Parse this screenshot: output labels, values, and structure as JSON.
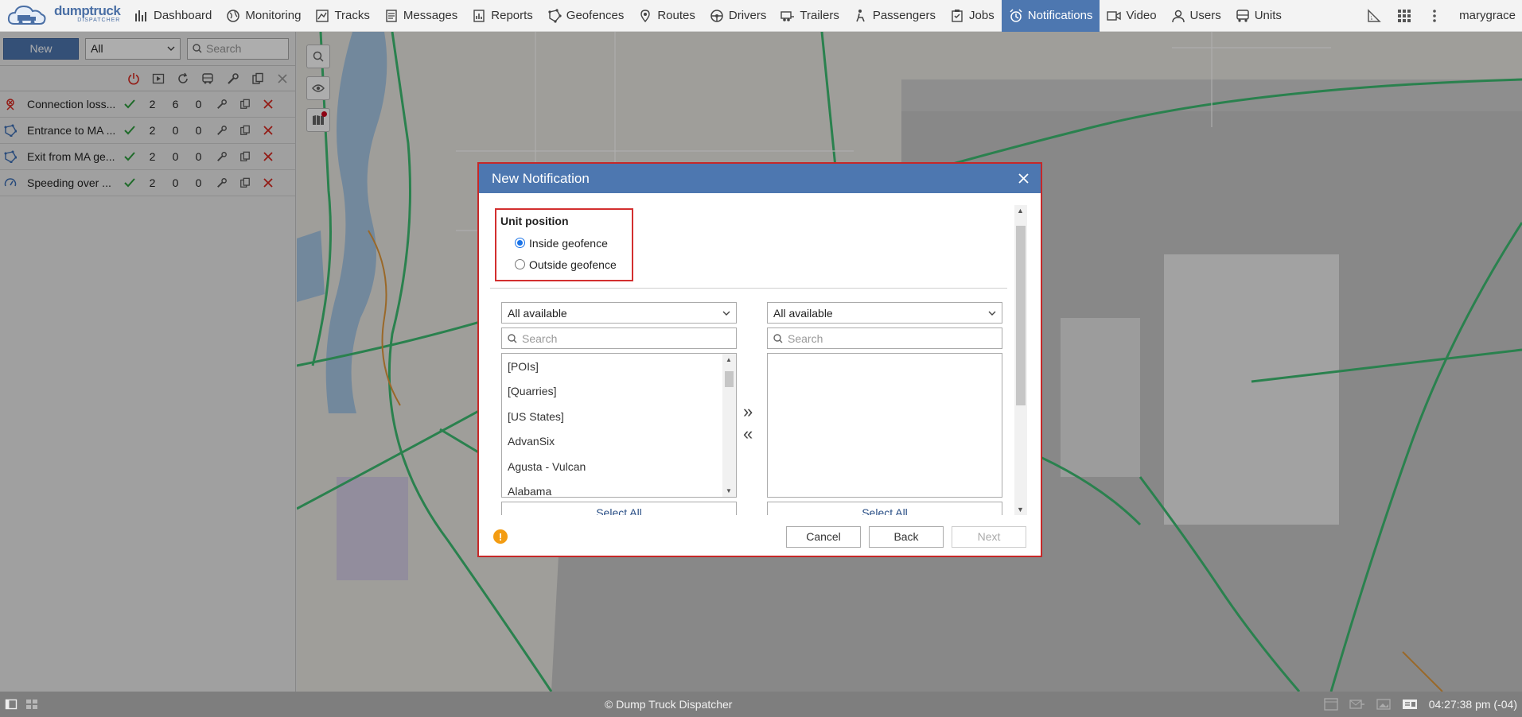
{
  "app": {
    "logo_main": "dumptruck",
    "logo_sub": "DISPATCHER",
    "username": "marygrace"
  },
  "nav": [
    {
      "label": "Dashboard",
      "icon": "bar-chart-icon"
    },
    {
      "label": "Monitoring",
      "icon": "globe-icon"
    },
    {
      "label": "Tracks",
      "icon": "track-icon"
    },
    {
      "label": "Messages",
      "icon": "messages-icon"
    },
    {
      "label": "Reports",
      "icon": "reports-icon"
    },
    {
      "label": "Geofences",
      "icon": "geofence-icon"
    },
    {
      "label": "Routes",
      "icon": "routes-icon"
    },
    {
      "label": "Drivers",
      "icon": "steering-wheel-icon"
    },
    {
      "label": "Trailers",
      "icon": "trailer-icon"
    },
    {
      "label": "Passengers",
      "icon": "passenger-icon"
    },
    {
      "label": "Jobs",
      "icon": "jobs-icon"
    },
    {
      "label": "Notifications",
      "icon": "alarm-clock-icon",
      "active": true
    },
    {
      "label": "Video",
      "icon": "video-icon"
    },
    {
      "label": "Users",
      "icon": "user-icon"
    },
    {
      "label": "Units",
      "icon": "bus-icon"
    }
  ],
  "left_panel": {
    "new_label": "New",
    "filter_value": "All",
    "search_placeholder": "Search",
    "rows": [
      {
        "name": "Connection loss...",
        "c1": "2",
        "c2": "6",
        "c3": "0",
        "icon": "connection-loss-icon"
      },
      {
        "name": "Entrance to MA ...",
        "c1": "2",
        "c2": "0",
        "c3": "0",
        "icon": "geofence-icon"
      },
      {
        "name": "Exit from MA ge...",
        "c1": "2",
        "c2": "0",
        "c3": "0",
        "icon": "geofence-icon"
      },
      {
        "name": "Speeding over ...",
        "c1": "2",
        "c2": "0",
        "c3": "0",
        "icon": "speedometer-icon"
      }
    ]
  },
  "dialog": {
    "title": "New Notification",
    "unit_position_header": "Unit position",
    "radio_inside": "Inside geofence",
    "radio_outside": "Outside geofence",
    "left_select": "All available",
    "right_select": "All available",
    "search_placeholder": "Search",
    "left_items": [
      "[POIs]",
      "[Quarries]",
      "[US States]",
      "AdvanSix",
      "Agusta - Vulcan",
      "Alabama"
    ],
    "select_all_label": "Select All",
    "move_right": "»",
    "move_left": "«",
    "cancel_label": "Cancel",
    "back_label": "Back",
    "next_label": "Next"
  },
  "statusbar": {
    "copyright": "© Dump Truck Dispatcher",
    "time": "04:27:38 pm (-04)"
  },
  "colors": {
    "accent": "#4d77b0",
    "highlight_border": "#d32f2f",
    "ok_green": "#2e9e3e",
    "delete_red": "#d9281f"
  }
}
